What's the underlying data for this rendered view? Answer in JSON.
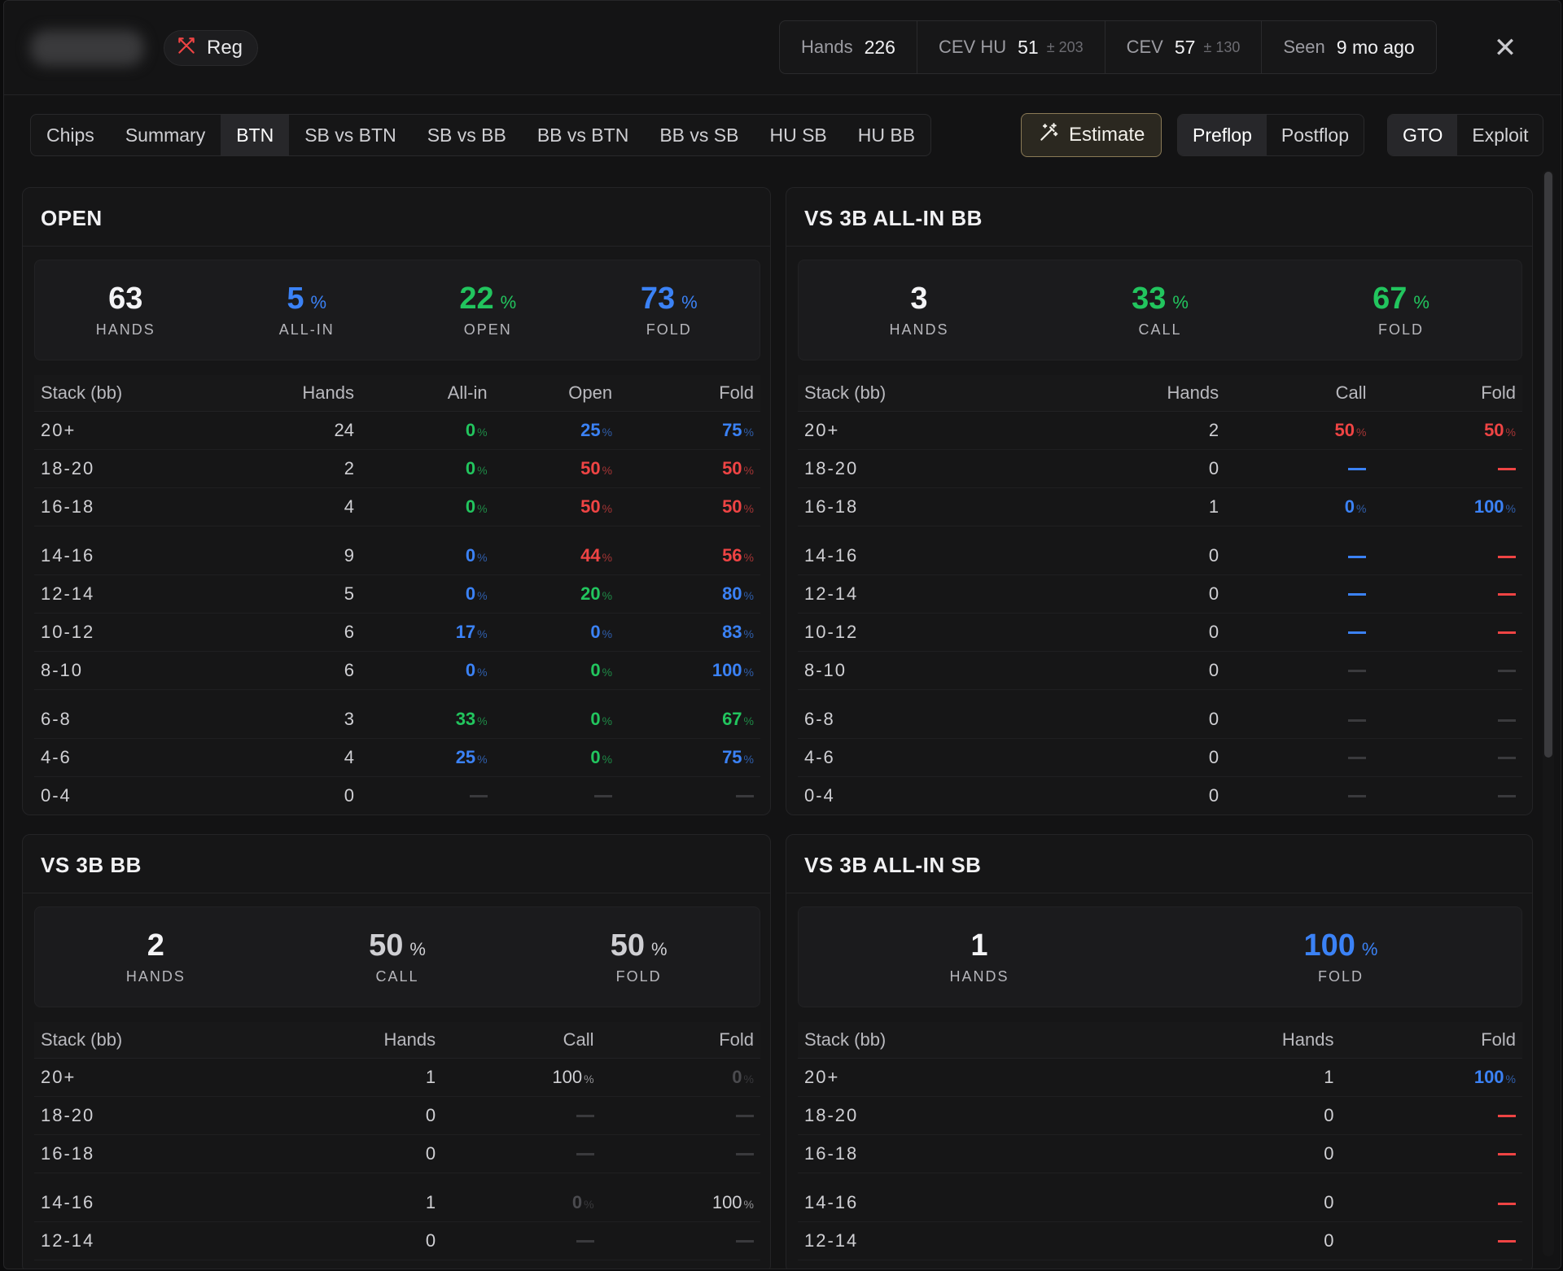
{
  "header": {
    "reg_label": "Reg",
    "stats": [
      {
        "label": "Hands",
        "value": "226",
        "pm": ""
      },
      {
        "label": "CEV HU",
        "value": "51",
        "pm": "± 203"
      },
      {
        "label": "CEV",
        "value": "57",
        "pm": "± 130"
      },
      {
        "label": "Seen",
        "value": "9 mo ago",
        "pm": ""
      }
    ]
  },
  "tabs": [
    "Chips",
    "Summary",
    "BTN",
    "SB vs BTN",
    "SB vs BB",
    "BB vs BTN",
    "BB vs SB",
    "HU SB",
    "HU BB"
  ],
  "active_tab": "BTN",
  "estimate_label": "Estimate",
  "street_toggle": [
    "Preflop",
    "Postflop"
  ],
  "mode_toggle": [
    "GTO",
    "Exploit"
  ],
  "colors": {
    "green": "#22c55e",
    "blue": "#3b82f6",
    "red": "#ef4444",
    "estimate_border": "#8a7a56"
  },
  "panels": [
    {
      "title": "OPEN",
      "summary": [
        {
          "num": "63",
          "pct": "",
          "label": "HANDS",
          "color": "white"
        },
        {
          "num": "5",
          "pct": "%",
          "label": "ALL-IN",
          "color": "blue"
        },
        {
          "num": "22",
          "pct": "%",
          "label": "OPEN",
          "color": "green"
        },
        {
          "num": "73",
          "pct": "%",
          "label": "FOLD",
          "color": "blue"
        }
      ],
      "headers": [
        "Stack (bb)",
        "Hands",
        "All-in",
        "Open",
        "Fold"
      ],
      "rows": [
        [
          "20+",
          "24",
          [
            "0",
            "green"
          ],
          [
            "25",
            "blue"
          ],
          [
            "75",
            "blue"
          ]
        ],
        [
          "18-20",
          "2",
          [
            "0",
            "green"
          ],
          [
            "50",
            "red"
          ],
          [
            "50",
            "red"
          ]
        ],
        [
          "16-18",
          "4",
          [
            "0",
            "green"
          ],
          [
            "50",
            "red"
          ],
          [
            "50",
            "red"
          ]
        ],
        [
          "14-16",
          "9",
          [
            "0",
            "blue"
          ],
          [
            "44",
            "red"
          ],
          [
            "56",
            "red"
          ]
        ],
        [
          "12-14",
          "5",
          [
            "0",
            "blue"
          ],
          [
            "20",
            "green"
          ],
          [
            "80",
            "blue"
          ]
        ],
        [
          "10-12",
          "6",
          [
            "17",
            "blue"
          ],
          [
            "0",
            "blue"
          ],
          [
            "83",
            "blue"
          ]
        ],
        [
          "8-10",
          "6",
          [
            "0",
            "blue"
          ],
          [
            "0",
            "green"
          ],
          [
            "100",
            "blue"
          ]
        ],
        [
          "6-8",
          "3",
          [
            "33",
            "green"
          ],
          [
            "0",
            "green"
          ],
          [
            "67",
            "green"
          ]
        ],
        [
          "4-6",
          "4",
          [
            "25",
            "blue"
          ],
          [
            "0",
            "green"
          ],
          [
            "75",
            "blue"
          ]
        ],
        [
          "0-4",
          "0",
          [
            "—",
            "dim"
          ],
          [
            "—",
            "dim"
          ],
          [
            "—",
            "dim"
          ]
        ]
      ]
    },
    {
      "title": "VS 3B ALL-IN BB",
      "summary": [
        {
          "num": "3",
          "pct": "",
          "label": "HANDS",
          "color": "white"
        },
        {
          "num": "33",
          "pct": "%",
          "label": "CALL",
          "color": "green"
        },
        {
          "num": "67",
          "pct": "%",
          "label": "FOLD",
          "color": "green"
        }
      ],
      "headers": [
        "Stack (bb)",
        "Hands",
        "Call",
        "Fold"
      ],
      "rows": [
        [
          "20+",
          "2",
          [
            "50",
            "red"
          ],
          [
            "50",
            "red"
          ]
        ],
        [
          "18-20",
          "0",
          [
            "—",
            "blue"
          ],
          [
            "—",
            "red"
          ]
        ],
        [
          "16-18",
          "1",
          [
            "0",
            "blue"
          ],
          [
            "100",
            "blue"
          ]
        ],
        [
          "14-16",
          "0",
          [
            "—",
            "blue"
          ],
          [
            "—",
            "red"
          ]
        ],
        [
          "12-14",
          "0",
          [
            "—",
            "blue"
          ],
          [
            "—",
            "red"
          ]
        ],
        [
          "10-12",
          "0",
          [
            "—",
            "blue"
          ],
          [
            "—",
            "red"
          ]
        ],
        [
          "8-10",
          "0",
          [
            "—",
            "dim"
          ],
          [
            "—",
            "dim"
          ]
        ],
        [
          "6-8",
          "0",
          [
            "—",
            "dim"
          ],
          [
            "—",
            "dim"
          ]
        ],
        [
          "4-6",
          "0",
          [
            "—",
            "dim"
          ],
          [
            "—",
            "dim"
          ]
        ],
        [
          "0-4",
          "0",
          [
            "—",
            "dim"
          ],
          [
            "—",
            "dim"
          ]
        ]
      ]
    },
    {
      "title": "VS 3B BB",
      "summary": [
        {
          "num": "2",
          "pct": "",
          "label": "HANDS",
          "color": "white"
        },
        {
          "num": "50",
          "pct": "%",
          "label": "CALL",
          "color": "gray"
        },
        {
          "num": "50",
          "pct": "%",
          "label": "FOLD",
          "color": "gray"
        }
      ],
      "headers": [
        "Stack (bb)",
        "Hands",
        "Call",
        "Fold"
      ],
      "rows": [
        [
          "20+",
          "1",
          [
            "100",
            "plain"
          ],
          [
            "0",
            "dim"
          ]
        ],
        [
          "18-20",
          "0",
          [
            "—",
            "dim"
          ],
          [
            "—",
            "dim"
          ]
        ],
        [
          "16-18",
          "0",
          [
            "—",
            "dim"
          ],
          [
            "—",
            "dim"
          ]
        ],
        [
          "14-16",
          "1",
          [
            "0",
            "dim"
          ],
          [
            "100",
            "plain"
          ]
        ],
        [
          "12-14",
          "0",
          [
            "—",
            "dim"
          ],
          [
            "—",
            "dim"
          ]
        ]
      ]
    },
    {
      "title": "VS 3B ALL-IN SB",
      "summary": [
        {
          "num": "1",
          "pct": "",
          "label": "HANDS",
          "color": "white"
        },
        {
          "num": "100",
          "pct": "%",
          "label": "FOLD",
          "color": "blue"
        }
      ],
      "headers": [
        "Stack (bb)",
        "Hands",
        "Fold"
      ],
      "rows": [
        [
          "20+",
          "1",
          [
            "100",
            "blue"
          ]
        ],
        [
          "18-20",
          "0",
          [
            "—",
            "red"
          ]
        ],
        [
          "16-18",
          "0",
          [
            "—",
            "red"
          ]
        ],
        [
          "14-16",
          "0",
          [
            "—",
            "red"
          ]
        ],
        [
          "12-14",
          "0",
          [
            "—",
            "red"
          ]
        ]
      ]
    }
  ]
}
